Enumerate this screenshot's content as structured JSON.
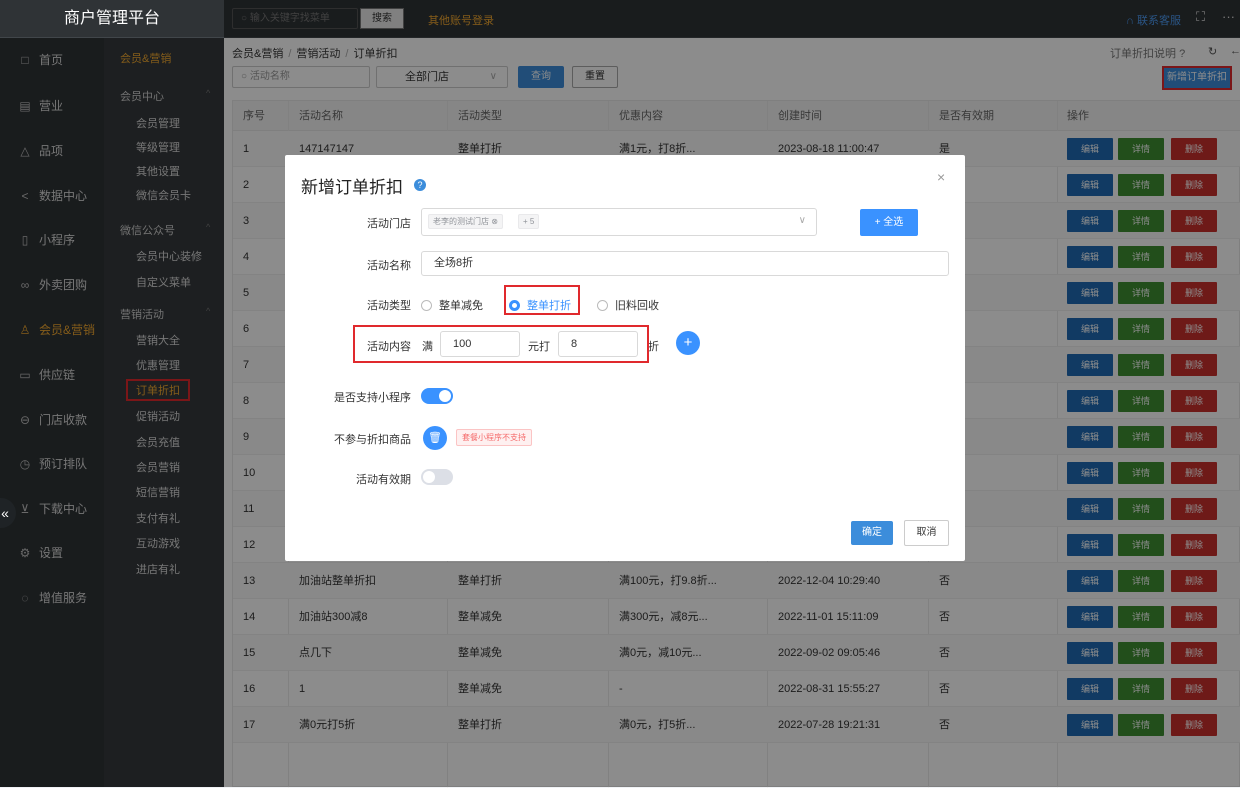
{
  "brand": "商户管理平台",
  "topbar": {
    "search_placeholder": "输入关键字找菜单",
    "search_button": "搜索",
    "other_login": "其他账号登录",
    "contact": "联系客服"
  },
  "rail": [
    {
      "icon": "home-icon",
      "glyph": "□",
      "label": "首页"
    },
    {
      "icon": "calendar-icon",
      "glyph": "▤",
      "label": "营业"
    },
    {
      "icon": "bag-icon",
      "glyph": "△",
      "label": "品项"
    },
    {
      "icon": "share-icon",
      "glyph": "<",
      "label": "数据中心"
    },
    {
      "icon": "phone-icon",
      "glyph": "▯",
      "label": "小程序"
    },
    {
      "icon": "delivery-icon",
      "glyph": "∞",
      "label": "外卖团购"
    },
    {
      "icon": "user-icon",
      "glyph": "♙",
      "label": "会员&营销"
    },
    {
      "icon": "truck-icon",
      "glyph": "▭",
      "label": "供应链"
    },
    {
      "icon": "cashier-icon",
      "glyph": "⊖",
      "label": "门店收款"
    },
    {
      "icon": "clock-icon",
      "glyph": "◷",
      "label": "预订排队"
    },
    {
      "icon": "download-icon",
      "glyph": "⊻",
      "label": "下载中心"
    },
    {
      "icon": "gear-icon",
      "glyph": "⚙",
      "label": "设置"
    },
    {
      "icon": "service-icon",
      "glyph": "◌",
      "label": "增值服务"
    }
  ],
  "submenu": {
    "top": "会员&营销",
    "groups": [
      {
        "title": "会员中心",
        "items": [
          "会员管理",
          "等级管理",
          "其他设置",
          "微信会员卡"
        ]
      },
      {
        "title": "微信公众号",
        "items": [
          "会员中心装修",
          "自定义菜单"
        ]
      },
      {
        "title": "营销活动",
        "items": [
          "营销大全",
          "优惠管理",
          "订单折扣",
          "促销活动",
          "会员充值",
          "会员营销",
          "短信营销",
          "支付有礼",
          "互动游戏",
          "进店有礼"
        ]
      }
    ]
  },
  "breadcrumb": [
    "会员&营销",
    "营销活动",
    "订单折扣"
  ],
  "help_link": "订单折扣说明",
  "filters": {
    "name_placeholder": "活动名称",
    "store_select": "全部门店",
    "query": "查询",
    "reset": "重置",
    "add": "新增订单折扣"
  },
  "table": {
    "headers": [
      "序号",
      "活动名称",
      "活动类型",
      "优惠内容",
      "创建时间",
      "是否有效期",
      "操作"
    ],
    "ops": [
      "编辑",
      "详情",
      "删除"
    ],
    "rows": [
      [
        "1",
        "147147147",
        "整单打折",
        "满1元，打8折...",
        "2023-08-18 11:00:47",
        "是"
      ],
      [
        "2",
        "",
        "",
        "",
        "",
        ""
      ],
      [
        "3",
        "",
        "",
        "",
        "",
        ""
      ],
      [
        "4",
        "",
        "",
        "",
        "",
        ""
      ],
      [
        "5",
        "",
        "",
        "",
        "",
        ""
      ],
      [
        "6",
        "",
        "",
        "",
        "",
        ""
      ],
      [
        "7",
        "",
        "",
        "",
        "",
        ""
      ],
      [
        "8",
        "",
        "",
        "",
        "",
        ""
      ],
      [
        "9",
        "",
        "",
        "",
        "",
        ""
      ],
      [
        "10",
        "",
        "",
        "",
        "",
        ""
      ],
      [
        "11",
        "",
        "",
        "",
        "",
        ""
      ],
      [
        "12",
        "",
        "",
        "",
        "",
        ""
      ],
      [
        "13",
        "加油站整单折扣",
        "整单打折",
        "满100元，打9.8折...",
        "2022-12-04 10:29:40",
        "否"
      ],
      [
        "14",
        "加油站300减8",
        "整单减免",
        "满300元，减8元...",
        "2022-11-01 15:11:09",
        "否"
      ],
      [
        "15",
        "点几下",
        "整单减免",
        "满0元，减10元...",
        "2022-09-02 09:05:46",
        "否"
      ],
      [
        "16",
        "1",
        "整单减免",
        "-",
        "2022-08-31 15:55:27",
        "否"
      ],
      [
        "17",
        "满0元打5折",
        "整单打折",
        "满0元，打5折...",
        "2022-07-28 19:21:31",
        "否"
      ]
    ]
  },
  "modal": {
    "title": "新增订单折扣",
    "store_label": "活动门店",
    "store_tag": "老李的测试门店",
    "store_more": "+ 5",
    "select_all": "+ 全选",
    "name_label": "活动名称",
    "name_value": "全场8折",
    "type_label": "活动类型",
    "type_options": [
      "整单减免",
      "整单打折",
      "旧料回收"
    ],
    "type_selected": 1,
    "content_label": "活动内容",
    "content_prefix": "满",
    "content_amount": "100",
    "content_mid": "元打",
    "content_discount": "8",
    "content_suffix": "折",
    "miniapp_label": "是否支持小程序",
    "miniapp_on": true,
    "exclude_label": "不参与折扣商品",
    "exclude_warning": "套餐小程序不支持",
    "validity_label": "活动有效期",
    "validity_on": false,
    "ok": "确定",
    "cancel": "取消"
  },
  "colors": {
    "accent": "#3a92ff",
    "highlight": "#e0292d",
    "menu_active": "#f0a830"
  }
}
